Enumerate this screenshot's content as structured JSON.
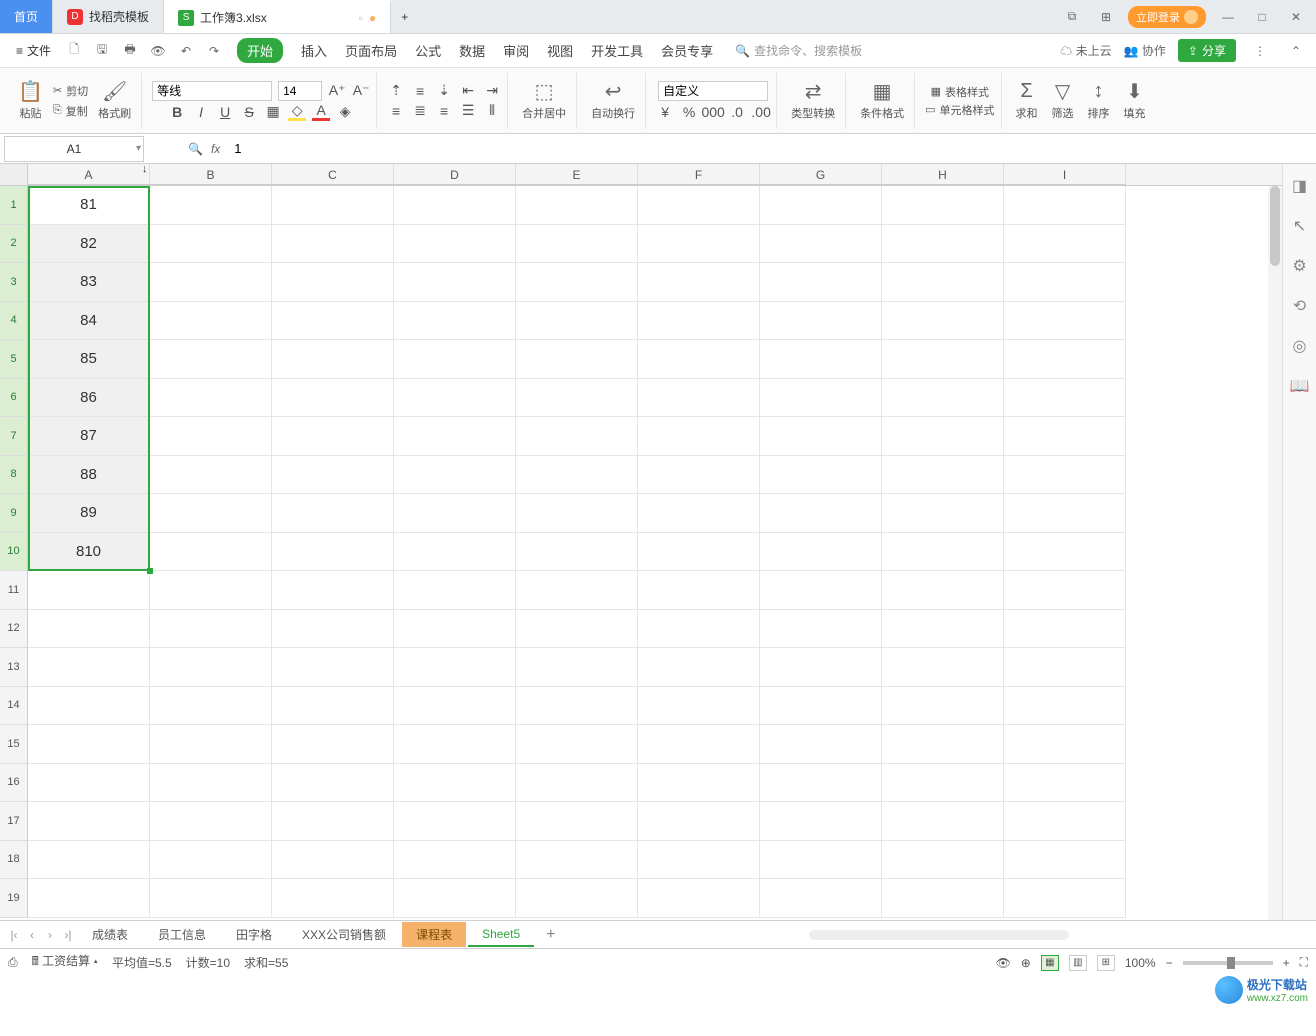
{
  "titlebar": {
    "home_tab": "首页",
    "template_tab": "找稻壳模板",
    "file_tab": "工作簿3.xlsx",
    "login_btn": "立即登录"
  },
  "menubar": {
    "file_label": "文件",
    "tabs": [
      "开始",
      "插入",
      "页面布局",
      "公式",
      "数据",
      "审阅",
      "视图",
      "开发工具",
      "会员专享"
    ],
    "search_placeholder": "查找命令、搜索模板",
    "cloud_label": "未上云",
    "collab_label": "协作",
    "share_label": "分享"
  },
  "ribbon": {
    "paste": "粘贴",
    "cut": "剪切",
    "copy": "复制",
    "format_painter": "格式刷",
    "font_name": "等线",
    "font_size": "14",
    "merge": "合并居中",
    "wrap": "自动换行",
    "number_format": "自定义",
    "type_convert": "类型转换",
    "cond_format": "条件格式",
    "table_style": "表格样式",
    "cell_style": "单元格样式",
    "sum": "求和",
    "filter": "筛选",
    "sort": "排序",
    "fill": "填充"
  },
  "namebox": "A1",
  "formula_bar": "1",
  "columns": [
    "A",
    "B",
    "C",
    "D",
    "E",
    "F",
    "G",
    "H",
    "I"
  ],
  "rows": [
    {
      "num": "1",
      "a": "81"
    },
    {
      "num": "2",
      "a": "82"
    },
    {
      "num": "3",
      "a": "83"
    },
    {
      "num": "4",
      "a": "84"
    },
    {
      "num": "5",
      "a": "85"
    },
    {
      "num": "6",
      "a": "86"
    },
    {
      "num": "7",
      "a": "87"
    },
    {
      "num": "8",
      "a": "88"
    },
    {
      "num": "9",
      "a": "89"
    },
    {
      "num": "10",
      "a": "810"
    }
  ],
  "empty_rows": [
    "11",
    "12",
    "13",
    "14",
    "15",
    "16",
    "17",
    "18",
    "19"
  ],
  "sheets": [
    "成绩表",
    "员工信息",
    "田字格",
    "XXX公司销售额",
    "课程表",
    "Sheet5"
  ],
  "statusbar": {
    "calc_label": "工资结算",
    "avg": "平均值=5.5",
    "count": "计数=10",
    "sum": "求和=55",
    "zoom": "100%"
  },
  "watermark": {
    "name": "极光下载站",
    "url": "www.xz7.com"
  }
}
